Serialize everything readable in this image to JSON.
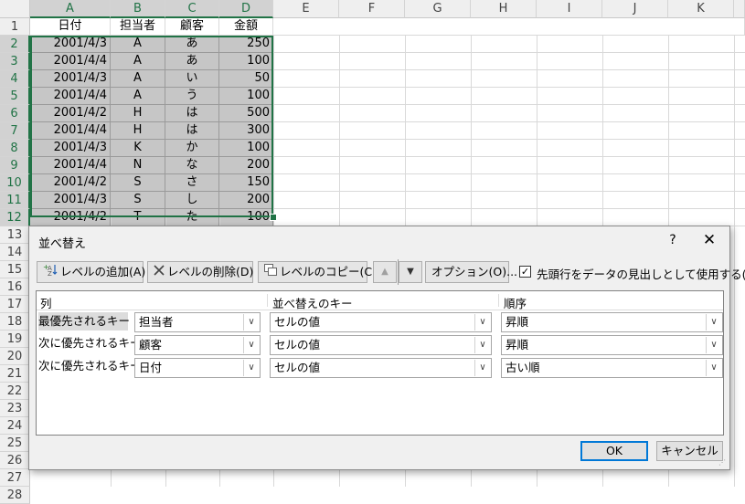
{
  "sheet": {
    "columns": [
      "A",
      "B",
      "C",
      "D",
      "E",
      "F",
      "G",
      "H",
      "I",
      "J",
      "K"
    ],
    "rows": [
      "1",
      "2",
      "3",
      "4",
      "5",
      "6",
      "7",
      "8",
      "9",
      "10",
      "11",
      "12",
      "13",
      "14",
      "15",
      "16",
      "17",
      "18",
      "19",
      "20",
      "21",
      "22",
      "23",
      "24",
      "25",
      "26",
      "27",
      "28"
    ],
    "header": [
      "日付",
      "担当者",
      "顧客",
      "金額"
    ],
    "data": [
      [
        "2001/4/3",
        "A",
        "あ",
        "250"
      ],
      [
        "2001/4/4",
        "A",
        "あ",
        "100"
      ],
      [
        "2001/4/3",
        "A",
        "い",
        "50"
      ],
      [
        "2001/4/4",
        "A",
        "う",
        "100"
      ],
      [
        "2001/4/2",
        "H",
        "は",
        "500"
      ],
      [
        "2001/4/4",
        "H",
        "は",
        "300"
      ],
      [
        "2001/4/3",
        "K",
        "か",
        "100"
      ],
      [
        "2001/4/4",
        "N",
        "な",
        "200"
      ],
      [
        "2001/4/2",
        "S",
        "さ",
        "150"
      ],
      [
        "2001/4/3",
        "S",
        "し",
        "200"
      ],
      [
        "2001/4/2",
        "T",
        "た",
        "100"
      ]
    ]
  },
  "dialog": {
    "title": "並べ替え",
    "help": "?",
    "close": "✕",
    "toolbar": {
      "add_level": "レベルの追加(A)",
      "delete_level": "レベルの削除(D)",
      "copy_level": "レベルのコピー(C)",
      "move_up": "▲",
      "move_down": "▼",
      "options": "オプション(O)...",
      "header_checkbox_mark": "✓",
      "header_checkbox_label": "先頭行をデータの見出しとして使用する(H)"
    },
    "grid": {
      "col_header": "列",
      "key_header": "並べ替えのキー",
      "order_header": "順序",
      "levels": [
        {
          "label": "最優先されるキー",
          "column": "担当者",
          "key": "セルの値",
          "order": "昇順"
        },
        {
          "label": "次に優先されるキー",
          "column": "顧客",
          "key": "セルの値",
          "order": "昇順"
        },
        {
          "label": "次に優先されるキー",
          "column": "日付",
          "key": "セルの値",
          "order": "古い順"
        }
      ]
    },
    "ok": "OK",
    "cancel": "キャンセル"
  }
}
